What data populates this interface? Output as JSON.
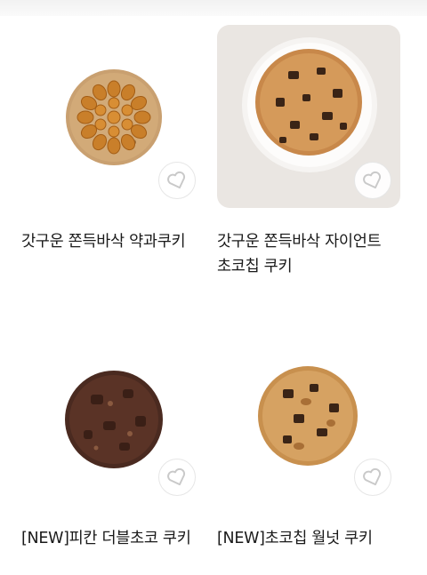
{
  "products": [
    {
      "title": "갓구운 쫀득바삭 약과쿠키",
      "wishlist_icon": "heart-outline-icon"
    },
    {
      "title": "갓구운 쫀득바삭 자이언트 초코칩 쿠키",
      "wishlist_icon": "heart-outline-icon"
    },
    {
      "title": "[NEW]피칸 더블초코 쿠키",
      "wishlist_icon": "heart-outline-icon"
    },
    {
      "title": "[NEW]초코칩 월넛 쿠키",
      "wishlist_icon": "heart-outline-icon"
    }
  ]
}
